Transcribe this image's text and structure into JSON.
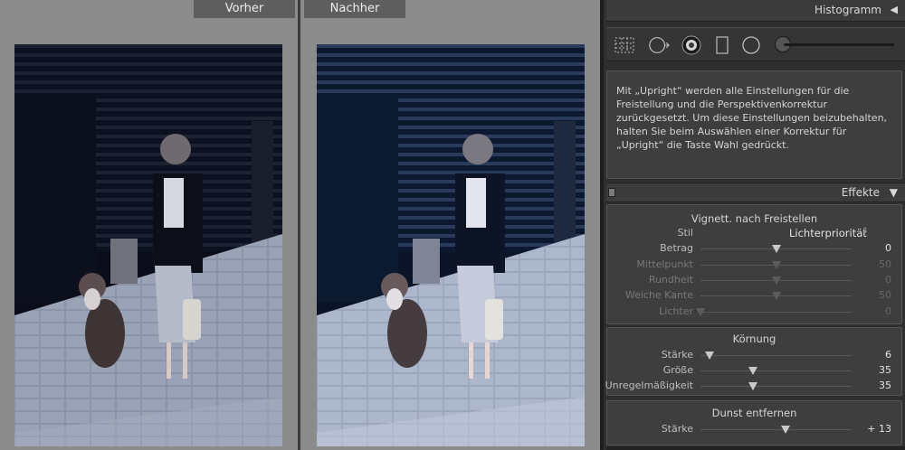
{
  "compare": {
    "before_label": "Vorher",
    "after_label": "Nachher"
  },
  "histogram": {
    "title": "Histogramm",
    "collapse_icon": "triangle-left-icon",
    "tools": [
      "crop-grid-icon",
      "spot-removal-icon",
      "red-eye-icon",
      "graduated-filter-icon",
      "radial-filter-icon",
      "adjustment-brush-icon"
    ]
  },
  "info": {
    "text": "Mit „Upright“ werden alle Einstellungen für die Freistellung und die Perspektivenkorrektur zurückgesetzt. Um diese Einstellungen beizubehalten, halten Sie beim Auswählen einer Korrektur für „Upright“ die Taste Wahl gedrückt."
  },
  "effects": {
    "title": "Effekte",
    "collapse_icon": "triangle-down-icon",
    "vignette": {
      "title": "Vignett. nach Freistellen",
      "style_label": "Stil",
      "style_value": "Lichterpriorität",
      "sliders": [
        {
          "label": "Betrag",
          "value": "0",
          "pos": 0.5,
          "dim": false
        },
        {
          "label": "Mittelpunkt",
          "value": "50",
          "pos": 0.5,
          "dim": true
        },
        {
          "label": "Rundheit",
          "value": "0",
          "pos": 0.5,
          "dim": true
        },
        {
          "label": "Weiche Kante",
          "value": "50",
          "pos": 0.5,
          "dim": true
        },
        {
          "label": "Lichter",
          "value": "0",
          "pos": 0.0,
          "dim": true
        }
      ]
    },
    "grain": {
      "title": "Körnung",
      "sliders": [
        {
          "label": "Stärke",
          "value": "6",
          "pos": 0.06,
          "dim": false
        },
        {
          "label": "Größe",
          "value": "35",
          "pos": 0.35,
          "dim": false
        },
        {
          "label": "Unregelmäßigkeit",
          "value": "35",
          "pos": 0.35,
          "dim": false
        }
      ]
    },
    "dehaze": {
      "title": "Dunst entfernen",
      "sliders": [
        {
          "label": "Stärke",
          "value": "+ 13",
          "pos": 0.565,
          "dim": false
        }
      ]
    }
  }
}
